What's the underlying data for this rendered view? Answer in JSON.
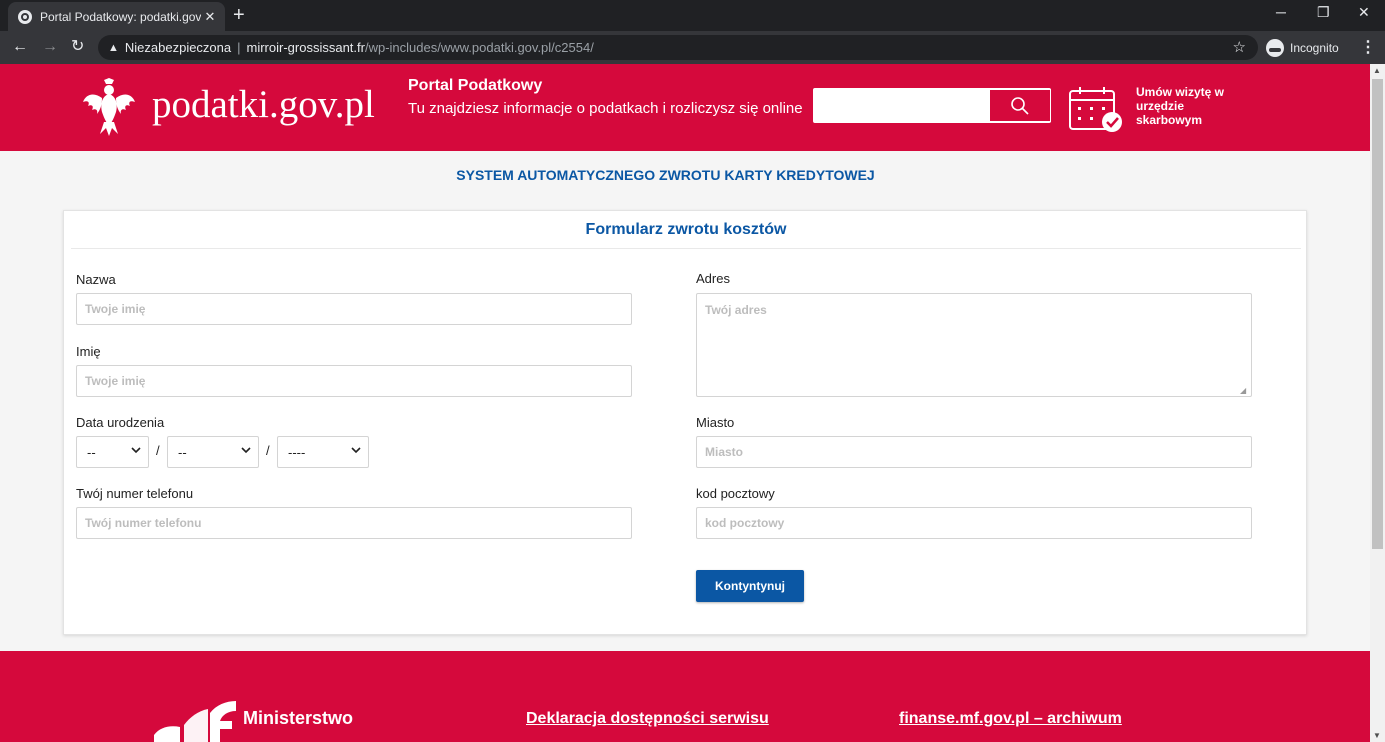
{
  "browser": {
    "tab_title": "Portal Podatkowy: podatki.gov.pl",
    "tab_close": "✕",
    "new_tab": "+",
    "security_label": "Niezabezpieczona",
    "url_host": "mirroir-grossissant.fr",
    "url_path": "/wp-includes/www.podatki.gov.pl/c2554/",
    "profile_label": "Incognito",
    "minimize": "─",
    "maximize": "❐",
    "close": "✕",
    "back": "←",
    "forward": "→",
    "reload": "↻",
    "star": "☆",
    "menu": "⋮"
  },
  "header": {
    "logo_text": "podatki.gov.pl",
    "portal_title": "Portal Podatkowy",
    "portal_subtitle": "Tu znajdziesz informacje o podatkach i rozliczysz się online",
    "search_value": "",
    "appointment_text": "Umów wizytę w urzędzie skarbowym",
    "brand_color": "#d5093c"
  },
  "main": {
    "system_title": "SYSTEM AUTOMATYCZNEGO ZWROTU KARTY KREDYTOWEJ",
    "form_title": "Formularz zwrotu kosztów",
    "fields": {
      "name_label": "Nazwa",
      "name_placeholder": "Twoje imię",
      "firstname_label": "Imię",
      "firstname_placeholder": "Twoje imię",
      "dob_label": "Data urodzenia",
      "dob_day": "--",
      "dob_month": "--",
      "dob_year": "----",
      "dob_separator": "/",
      "phone_label": "Twój numer telefonu",
      "phone_placeholder": "Twój numer telefonu",
      "address_label": "Adres",
      "address_placeholder": "Twój adres",
      "city_label": "Miasto",
      "city_placeholder": "Miasto",
      "postal_label": "kod pocztowy",
      "postal_placeholder": "kod pocztowy"
    },
    "continue_button": "Kontyntynuj",
    "accent_color": "#0b57a4"
  },
  "footer": {
    "ministry_text": "Ministerstwo",
    "link_accessibility": "Deklaracja dostępności serwisu",
    "link_archive": "finanse.mf.gov.pl – archiwum"
  }
}
